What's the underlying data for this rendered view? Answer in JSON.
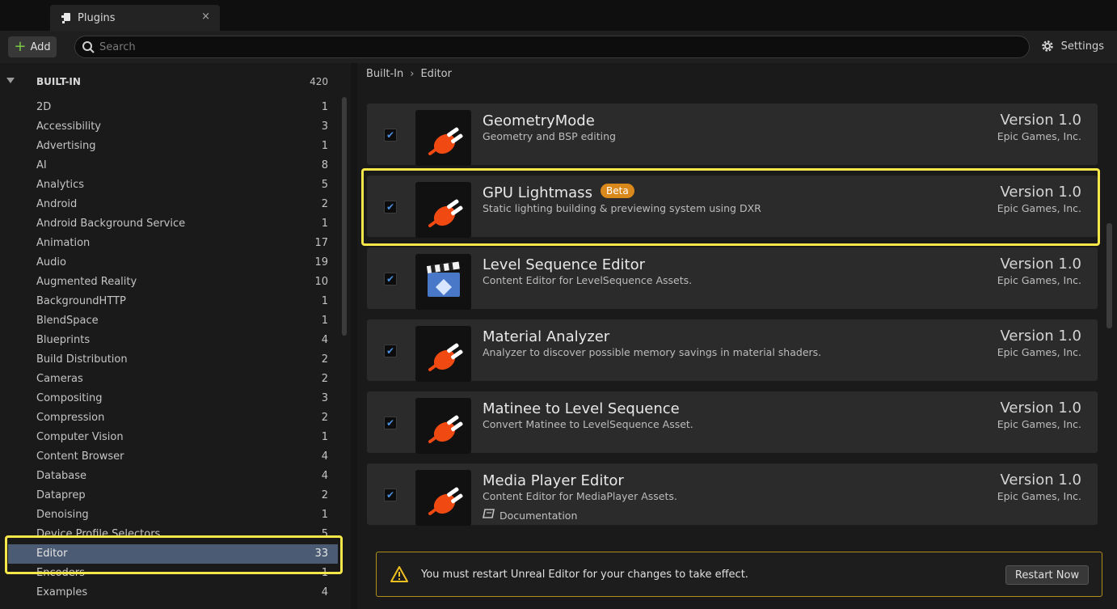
{
  "tab": {
    "title": "Plugins",
    "close": "×"
  },
  "toolbar": {
    "add_label": "Add",
    "search_placeholder": "Search",
    "settings_label": "Settings"
  },
  "sidebar": {
    "header": {
      "label": "BUILT-IN",
      "count": "420"
    },
    "items": [
      {
        "label": "2D",
        "count": "1"
      },
      {
        "label": "Accessibility",
        "count": "3"
      },
      {
        "label": "Advertising",
        "count": "1"
      },
      {
        "label": "AI",
        "count": "8"
      },
      {
        "label": "Analytics",
        "count": "5"
      },
      {
        "label": "Android",
        "count": "2"
      },
      {
        "label": "Android Background Service",
        "count": "1"
      },
      {
        "label": "Animation",
        "count": "17"
      },
      {
        "label": "Audio",
        "count": "19"
      },
      {
        "label": "Augmented Reality",
        "count": "10"
      },
      {
        "label": "BackgroundHTTP",
        "count": "1"
      },
      {
        "label": "BlendSpace",
        "count": "1"
      },
      {
        "label": "Blueprints",
        "count": "4"
      },
      {
        "label": "Build Distribution",
        "count": "2"
      },
      {
        "label": "Cameras",
        "count": "2"
      },
      {
        "label": "Compositing",
        "count": "3"
      },
      {
        "label": "Compression",
        "count": "2"
      },
      {
        "label": "Computer Vision",
        "count": "1"
      },
      {
        "label": "Content Browser",
        "count": "4"
      },
      {
        "label": "Database",
        "count": "4"
      },
      {
        "label": "Dataprep",
        "count": "2"
      },
      {
        "label": "Denoising",
        "count": "1"
      },
      {
        "label": "Device Profile Selectors",
        "count": "5"
      },
      {
        "label": "Editor",
        "count": "33"
      },
      {
        "label": "Encoders",
        "count": "1"
      },
      {
        "label": "Examples",
        "count": "4"
      }
    ]
  },
  "breadcrumb": {
    "root": "Built-In",
    "sep": "›",
    "current": "Editor"
  },
  "plugins": [
    {
      "name": "GeometryMode",
      "desc": "Geometry and BSP editing",
      "version": "Version 1.0",
      "author": "Epic Games, Inc.",
      "icon": "plug-icon",
      "checked": true
    },
    {
      "name": "GPU Lightmass",
      "badge": "Beta",
      "desc": "Static lighting building & previewing system using DXR",
      "version": "Version 1.0",
      "author": "Epic Games, Inc.",
      "icon": "plug-icon",
      "checked": true
    },
    {
      "name": "Level Sequence Editor",
      "desc": "Content Editor for LevelSequence Assets.",
      "version": "Version 1.0",
      "author": "Epic Games, Inc.",
      "icon": "clapperboard-icon",
      "checked": true
    },
    {
      "name": "Material Analyzer",
      "desc": "Analyzer to discover possible memory savings in material shaders.",
      "version": "Version 1.0",
      "author": "Epic Games, Inc.",
      "icon": "plug-icon",
      "checked": true
    },
    {
      "name": "Matinee to Level Sequence",
      "desc": "Convert Matinee to LevelSequence Asset.",
      "version": "Version 1.0",
      "author": "Epic Games, Inc.",
      "icon": "plug-icon",
      "checked": true
    },
    {
      "name": "Media Player Editor",
      "desc": "Content Editor for MediaPlayer Assets.",
      "version": "Version 1.0",
      "author": "Epic Games, Inc.",
      "icon": "plug-icon",
      "checked": true,
      "doc": "Documentation"
    }
  ],
  "notice": {
    "message": "You must restart Unreal Editor for your changes to take effect.",
    "button": "Restart Now"
  },
  "colors": {
    "selection": "#4a5b73",
    "highlight": "#f5e64a",
    "plug": "#f04a12",
    "beta": "#d9881c",
    "warning": "#f0c020"
  }
}
